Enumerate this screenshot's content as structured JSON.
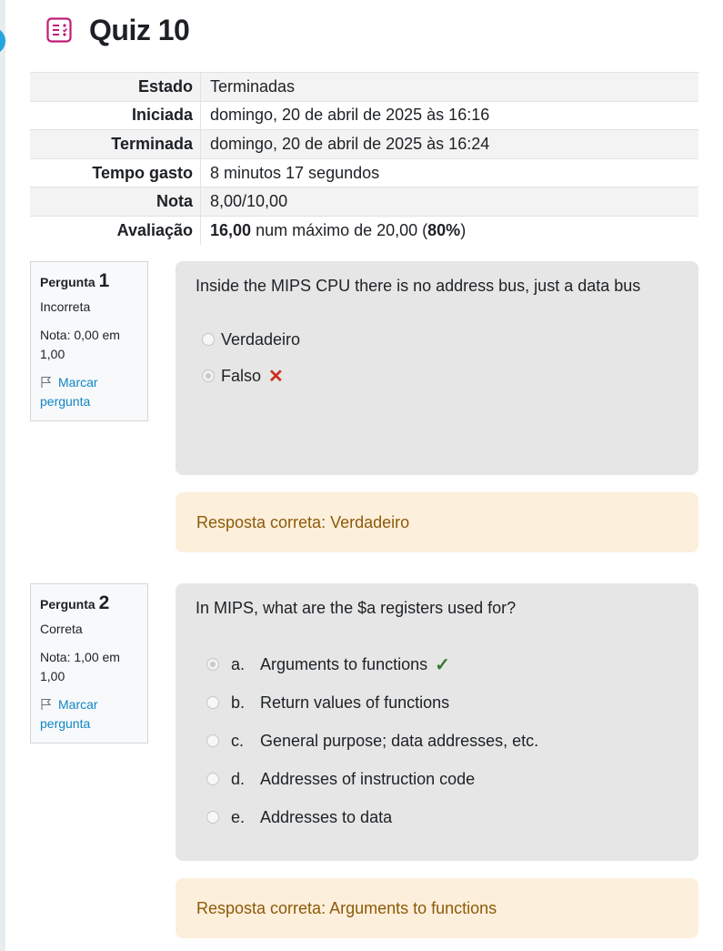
{
  "page": {
    "title": "Quiz 10"
  },
  "summary": [
    {
      "label": "Estado",
      "value": "Terminadas"
    },
    {
      "label": "Iniciada",
      "value": "domingo, 20 de abril de 2025 às 16:16"
    },
    {
      "label": "Terminada",
      "value": "domingo, 20 de abril de 2025 às 16:24"
    },
    {
      "label": "Tempo gasto",
      "value": "8 minutos 17 segundos"
    },
    {
      "label": "Nota",
      "value": "8,00/10,00"
    },
    {
      "label": "Avaliação",
      "grade": "16,00",
      "mid": "num máximo de 20,00 (",
      "percent": "80%",
      "end": ")"
    }
  ],
  "questions": [
    {
      "label": "Pergunta",
      "number": "1",
      "state": "Incorreta",
      "grade": "Nota: 0,00 em 1,00",
      "flag": "Marcar pergunta",
      "text": "Inside the MIPS CPU there is no address bus, just a data bus",
      "options": [
        {
          "text": "Verdadeiro",
          "selected": false
        },
        {
          "text": "Falso",
          "selected": true,
          "mark": "✕"
        }
      ],
      "feedback": "Resposta correta: Verdadeiro"
    },
    {
      "label": "Pergunta",
      "number": "2",
      "state": "Correta",
      "grade": "Nota: 1,00 em 1,00",
      "flag": "Marcar pergunta",
      "text": "In MIPS, what are the $a registers used for?",
      "options": [
        {
          "letter": "a.",
          "text": "Arguments to functions",
          "selected": true,
          "mark": "✓"
        },
        {
          "letter": "b.",
          "text": "Return values of functions",
          "selected": false
        },
        {
          "letter": "c.",
          "text": "General purpose; data addresses, etc.",
          "selected": false
        },
        {
          "letter": "d.",
          "text": "Addresses of instruction code",
          "selected": false
        },
        {
          "letter": "e.",
          "text": "Addresses to data",
          "selected": false
        }
      ],
      "feedback": "Resposta correta: Arguments to functions"
    }
  ],
  "colors": {
    "accent_icon": "#c01c77",
    "link": "#0f86c6",
    "incorrect": "#ca3120",
    "correct": "#357a32",
    "feedback_bg": "#fcefdc",
    "feedback_text": "#8e5a07"
  }
}
